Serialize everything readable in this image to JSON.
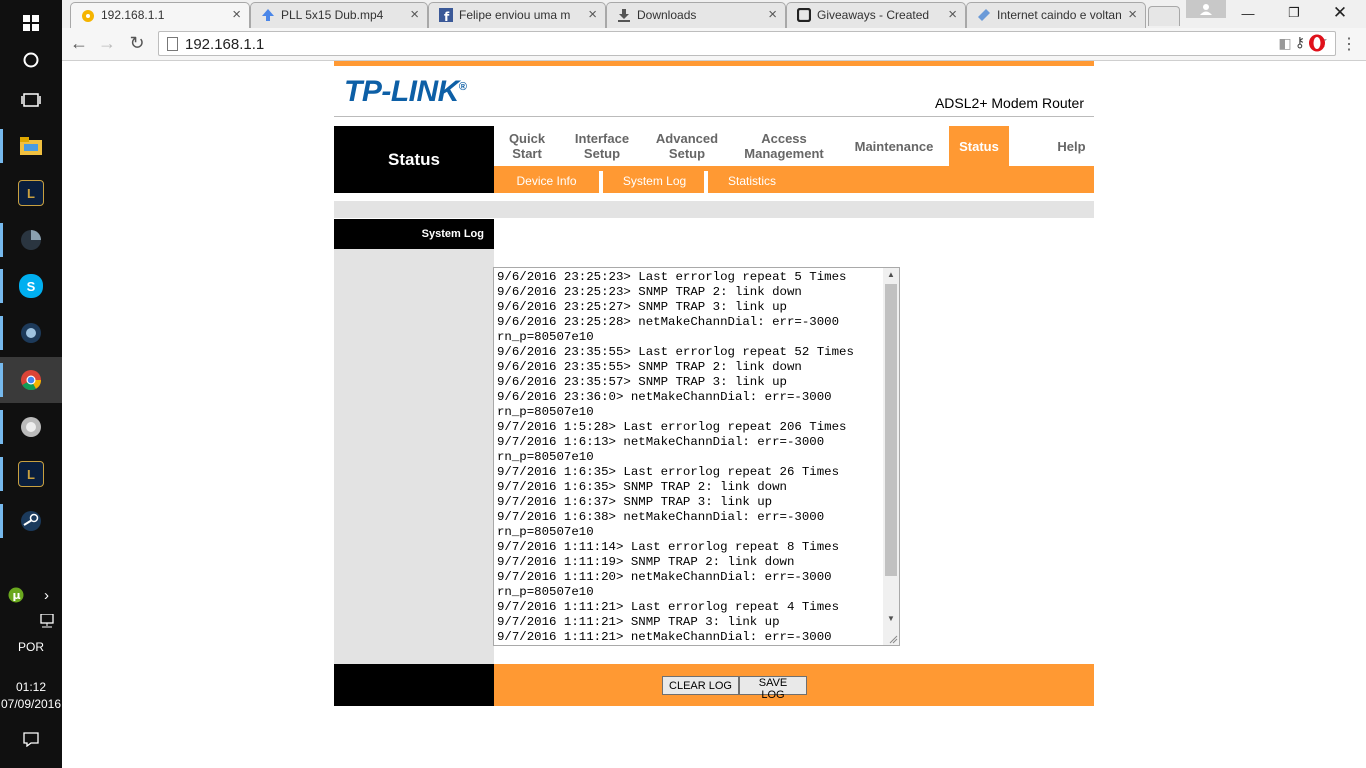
{
  "taskbar": {
    "lang": "POR",
    "time": "01:12",
    "date": "07/09/2016"
  },
  "tabs": [
    {
      "title": "192.168.1.1"
    },
    {
      "title": "PLL 5x15 Dub.mp4"
    },
    {
      "title": "Felipe enviou uma m"
    },
    {
      "title": "Downloads"
    },
    {
      "title": "Giveaways - Created"
    },
    {
      "title": "Internet caindo e voltan"
    }
  ],
  "toolbar": {
    "url": "192.168.1.1"
  },
  "router": {
    "logo": "TP-LINK",
    "logo_mark": "®",
    "model": "ADSL2+ Modem Router",
    "section_title": "Status",
    "menu": [
      {
        "label": "Quick Start"
      },
      {
        "label": "Interface Setup"
      },
      {
        "label": "Advanced Setup"
      },
      {
        "label": "Access Management"
      },
      {
        "label": "Maintenance"
      },
      {
        "label": "Status"
      },
      {
        "label": "Help"
      }
    ],
    "submenu": [
      {
        "label": "Device Info"
      },
      {
        "label": "System Log"
      },
      {
        "label": "Statistics"
      }
    ],
    "subsection_title": "System Log",
    "log_lines": [
      "9/6/2016 23:25:23> Last errorlog repeat 5 Times",
      "9/6/2016 23:25:23> SNMP TRAP 2: link down",
      "9/6/2016 23:25:27> SNMP TRAP 3: link up",
      "9/6/2016 23:25:28> netMakeChannDial: err=-3000",
      "rn_p=80507e10",
      "9/6/2016 23:35:55> Last errorlog repeat 52 Times",
      "9/6/2016 23:35:55> SNMP TRAP 2: link down",
      "9/6/2016 23:35:57> SNMP TRAP 3: link up",
      "9/6/2016 23:36:0> netMakeChannDial: err=-3000",
      "rn_p=80507e10",
      "9/7/2016 1:5:28> Last errorlog repeat 206 Times",
      "9/7/2016 1:6:13> netMakeChannDial: err=-3000",
      "rn_p=80507e10",
      "9/7/2016 1:6:35> Last errorlog repeat 26 Times",
      "9/7/2016 1:6:35> SNMP TRAP 2: link down",
      "9/7/2016 1:6:37> SNMP TRAP 3: link up",
      "9/7/2016 1:6:38> netMakeChannDial: err=-3000",
      "rn_p=80507e10",
      "9/7/2016 1:11:14> Last errorlog repeat 8 Times",
      "9/7/2016 1:11:19> SNMP TRAP 2: link down",
      "9/7/2016 1:11:20> netMakeChannDial: err=-3000",
      "rn_p=80507e10",
      "9/7/2016 1:11:21> Last errorlog repeat 4 Times",
      "9/7/2016 1:11:21> SNMP TRAP 3: link up",
      "9/7/2016 1:11:21> netMakeChannDial: err=-3000"
    ],
    "clear_log_label": "CLEAR LOG",
    "save_log_label": "SAVE LOG",
    "accent_color": "#ff9933"
  }
}
